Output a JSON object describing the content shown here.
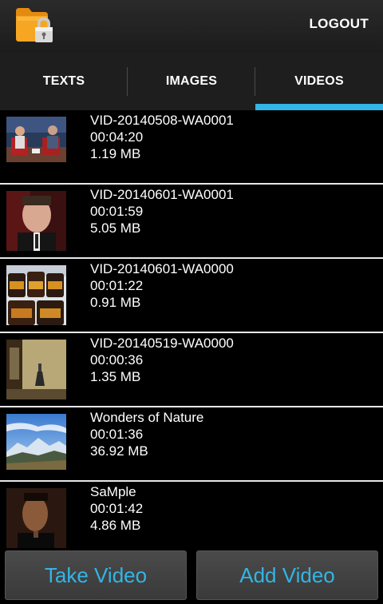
{
  "actionbar": {
    "logout_label": "LOGOUT",
    "app_icon": "folder-lock-icon"
  },
  "tabs": [
    {
      "label": "TEXTS",
      "selected": false
    },
    {
      "label": "IMAGES",
      "selected": false
    },
    {
      "label": "VIDEOS",
      "selected": true
    }
  ],
  "colors": {
    "accent": "#33b5e5",
    "background": "#000000",
    "actionbar": "#222222"
  },
  "videos": [
    {
      "name": "VID-20140508-WA0001",
      "duration": "00:04:20",
      "size": "1.19 MB"
    },
    {
      "name": "VID-20140601-WA0001",
      "duration": "00:01:59",
      "size": "5.05 MB"
    },
    {
      "name": "VID-20140601-WA0000",
      "duration": "00:01:22",
      "size": "0.91 MB"
    },
    {
      "name": "VID-20140519-WA0000",
      "duration": "00:00:36",
      "size": "1.35 MB"
    },
    {
      "name": "Wonders of Nature",
      "duration": "00:01:36",
      "size": "36.92 MB"
    },
    {
      "name": "SaMple",
      "duration": "00:01:42",
      "size": "4.86 MB"
    }
  ],
  "buttons": {
    "take_video": "Take Video",
    "add_video": "Add Video"
  }
}
